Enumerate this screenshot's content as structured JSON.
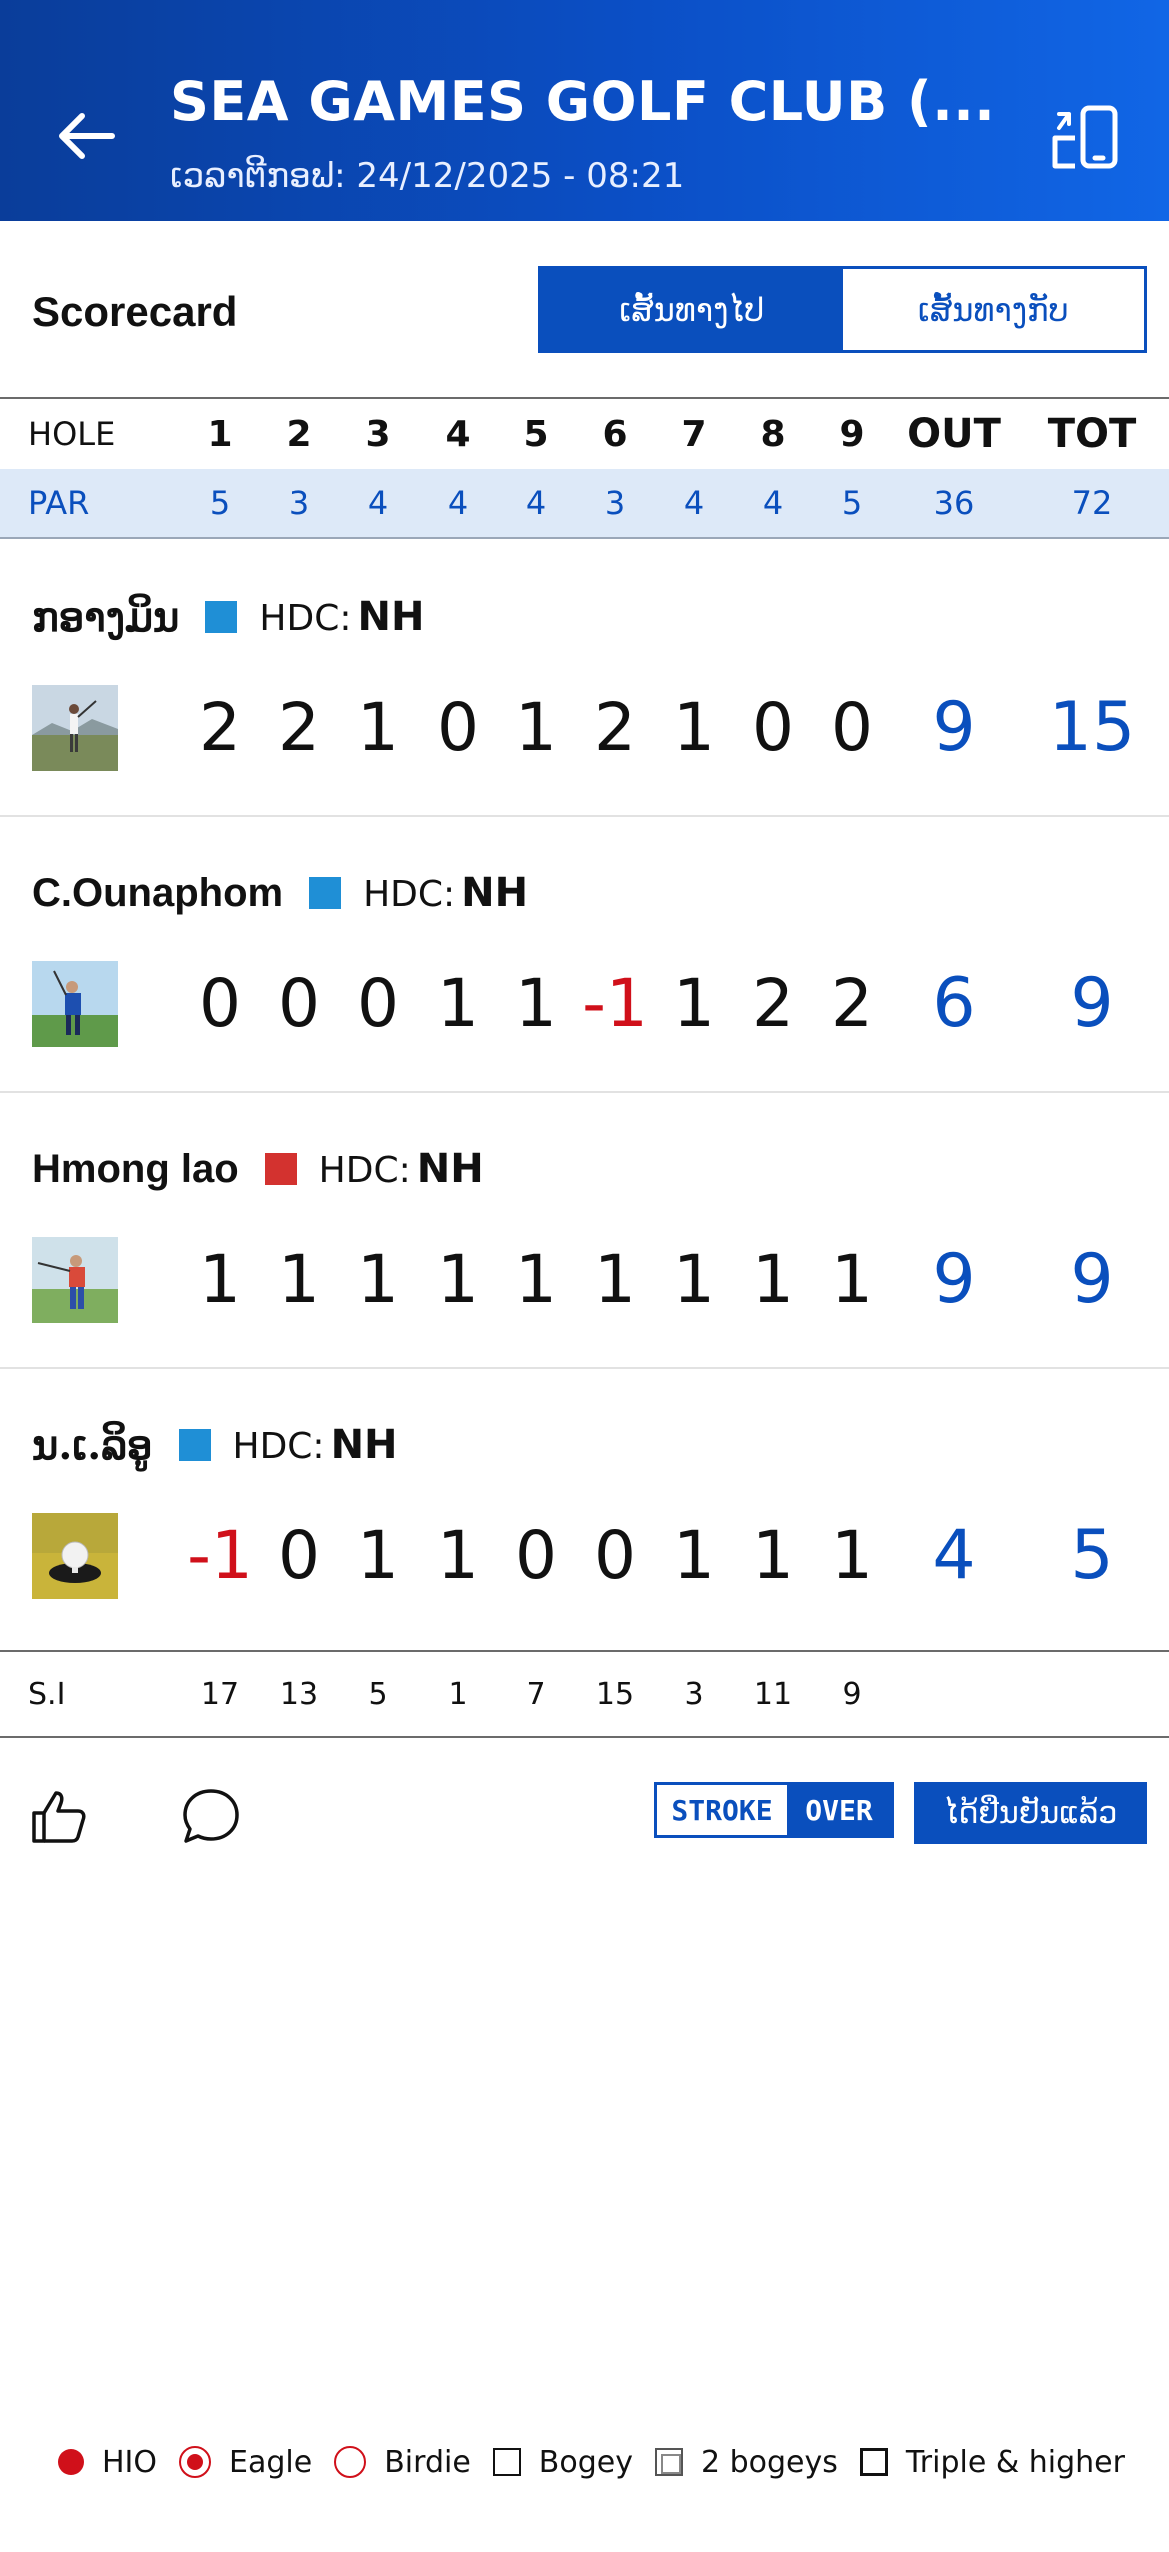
{
  "header": {
    "title": "SEA GAMES GOLF CLUB (...",
    "tee_time_label": "ເວລາຕີກອຟ:",
    "tee_time": "24/12/2025 - 08:21",
    "back_icon": "arrow-left-icon",
    "rotate_icon": "screen-rotate-icon"
  },
  "scorecard": {
    "label": "Scorecard",
    "tabs": [
      {
        "label": "ເສັ້ນທາງໄປ",
        "active": true
      },
      {
        "label": "ເສັ້ນທາງກັບ",
        "active": false
      }
    ]
  },
  "table": {
    "hole_label": "HOLE",
    "holes": [
      "1",
      "2",
      "3",
      "4",
      "5",
      "6",
      "7",
      "8",
      "9"
    ],
    "out_label": "OUT",
    "tot_label": "TOT",
    "par_label": "PAR",
    "par": [
      "5",
      "3",
      "4",
      "4",
      "4",
      "3",
      "4",
      "4",
      "5"
    ],
    "par_out": "36",
    "par_tot": "72",
    "hdc_label": "HDC:",
    "players": [
      {
        "name": "ກອາງມິນ",
        "flag_color": "#1f8fd6",
        "hdc": "NH",
        "scores": [
          "2",
          "2",
          "1",
          "0",
          "1",
          "2",
          "1",
          "0",
          "0"
        ],
        "out": "9",
        "tot": "15"
      },
      {
        "name": "C.Ounaphom",
        "flag_color": "#1f8fd6",
        "hdc": "NH",
        "scores": [
          "0",
          "0",
          "0",
          "1",
          "1",
          "-1",
          "1",
          "2",
          "2"
        ],
        "out": "6",
        "tot": "9"
      },
      {
        "name": "Hmong lao",
        "flag_color": "#d3322f",
        "hdc": "NH",
        "scores": [
          "1",
          "1",
          "1",
          "1",
          "1",
          "1",
          "1",
          "1",
          "1"
        ],
        "out": "9",
        "tot": "9"
      },
      {
        "name": "ນ.ເ.ລິອູ",
        "flag_color": "#1f8fd6",
        "hdc": "NH",
        "scores": [
          "-1",
          "0",
          "1",
          "1",
          "0",
          "0",
          "1",
          "1",
          "1"
        ],
        "out": "4",
        "tot": "5"
      }
    ],
    "si_label": "S.I",
    "si": [
      "17",
      "13",
      "5",
      "1",
      "7",
      "15",
      "3",
      "11",
      "9"
    ]
  },
  "actions": {
    "like_icon": "thumbs-up-icon",
    "comment_icon": "comment-icon",
    "mode_stroke": "STROKE",
    "mode_over": "OVER",
    "confirm_label": "ໄດ້ຢືນຢັນແລ້ວ"
  },
  "legend": [
    {
      "symbol": "hio",
      "label": "HIO"
    },
    {
      "symbol": "eagle",
      "label": "Eagle"
    },
    {
      "symbol": "birdie",
      "label": "Birdie"
    },
    {
      "symbol": "bogey",
      "label": "Bogey"
    },
    {
      "symbol": "bogey2",
      "label": "2 bogeys"
    },
    {
      "symbol": "triple",
      "label": "Triple & higher"
    }
  ],
  "colors": {
    "accent": "#0a4fbd",
    "negative": "#d0101a",
    "par_row_bg": "#dde9f8"
  }
}
